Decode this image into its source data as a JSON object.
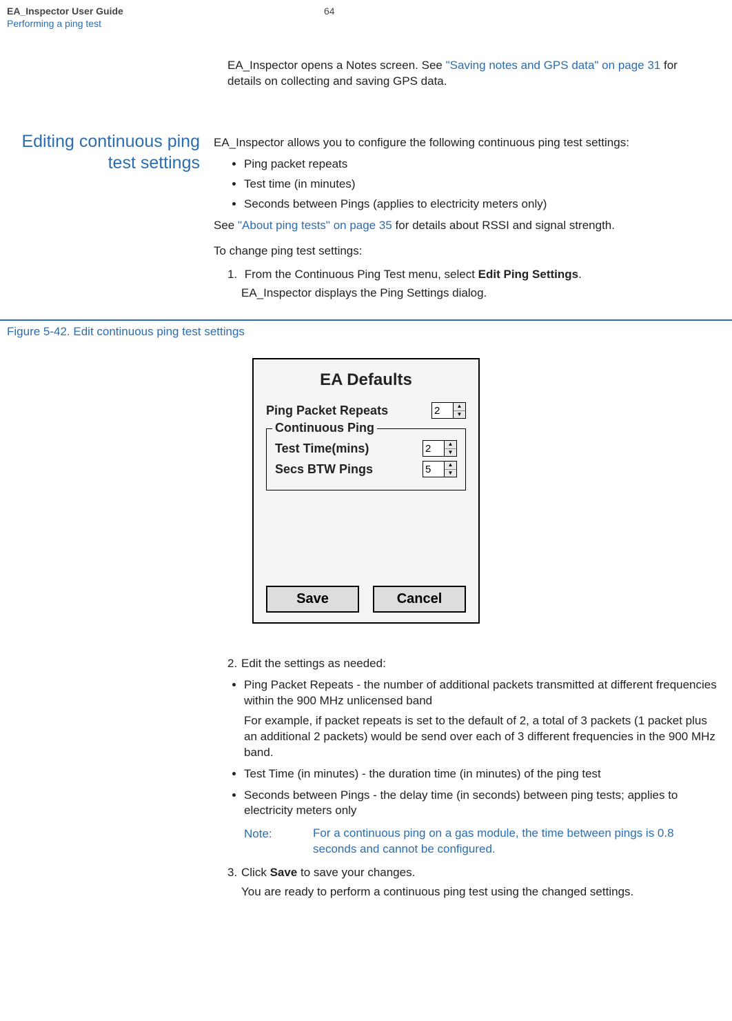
{
  "header": {
    "title": "EA_Inspector User Guide",
    "subtitle": "Performing a ping test",
    "page": "64"
  },
  "intro": {
    "prefix": "EA_Inspector opens a Notes screen. See ",
    "link": "\"Saving notes and GPS data\" on page 31",
    "suffix": " for details on collecting and saving GPS data."
  },
  "section_heading": "Editing continuous ping test settings",
  "body": {
    "lead": "EA_Inspector allows you to configure the following continuous ping test settings:",
    "bullets": [
      "Ping packet repeats",
      "Test time (in minutes)",
      "Seconds between Pings (applies to electricity meters only)"
    ],
    "see_prefix": "See ",
    "see_link": "\"About ping tests\" on page 35",
    "see_suffix": " for details about RSSI and signal strength.",
    "to_change": "To change ping test settings:",
    "step1_num": "1.",
    "step1_a": "From the Continuous Ping Test menu, select ",
    "step1_bold": "Edit Ping Settings",
    "step1_b": ".",
    "step1_sub": "EA_Inspector displays the Ping Settings dialog."
  },
  "figure_caption": "Figure 5-42. Edit continuous ping test settings",
  "dialog": {
    "title": "EA Defaults",
    "ppr_label": "Ping Packet Repeats",
    "ppr_value": "2",
    "group_label": "Continuous Ping",
    "tt_label": "Test Time(mins)",
    "tt_value": "2",
    "sbp_label": "Secs BTW Pings",
    "sbp_value": "5",
    "save": "Save",
    "cancel": "Cancel"
  },
  "step2": {
    "num": "2.",
    "text": "Edit the settings as needed:",
    "b1": "Ping Packet Repeats - the number of additional packets transmitted at different frequencies within the 900 MHz unlicensed band",
    "b1_sub": "For example, if packet repeats is set to the default of 2, a total of 3 packets (1 packet plus an additional 2 packets) would be send over each of 3 different frequencies in the 900 MHz band.",
    "b2": "Test Time (in minutes) - the duration time (in minutes) of the ping test",
    "b3": "Seconds between Pings - the delay time (in seconds) between ping tests; applies to electricity meters only"
  },
  "note": {
    "label": "Note:",
    "text": "For a continuous ping on a gas module, the time between pings is 0.8 seconds and cannot be configured."
  },
  "step3": {
    "num": "3.",
    "a": "Click ",
    "bold": "Save",
    "b": " to save your changes.",
    "sub": "You are ready to perform a continuous ping test using the changed settings."
  }
}
